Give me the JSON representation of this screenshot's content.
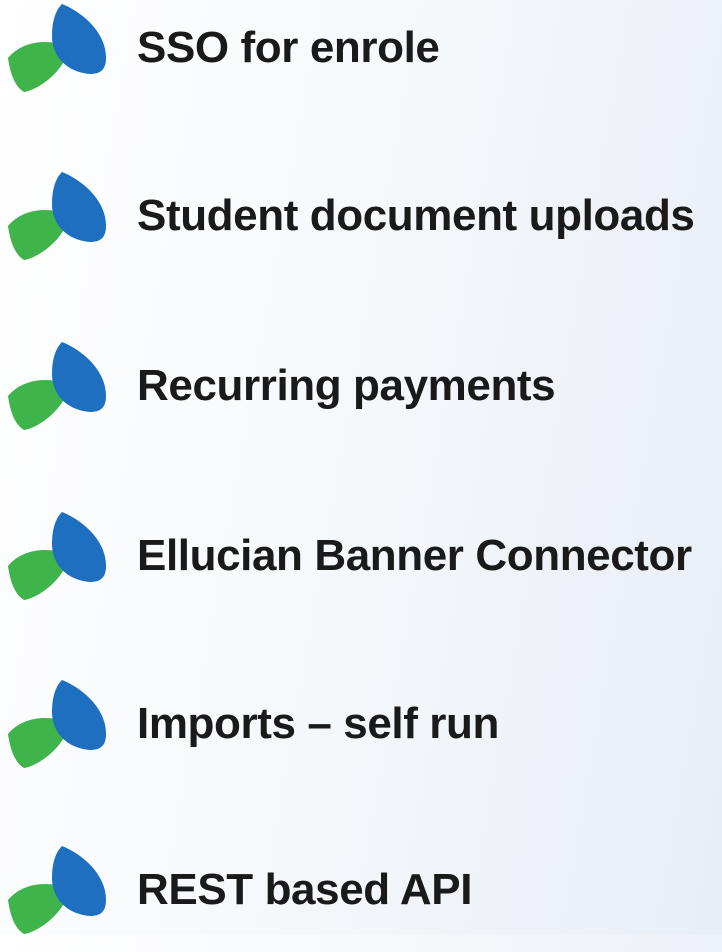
{
  "items": [
    {
      "label": "SSO for enrole",
      "icon": "leaf-logo-icon"
    },
    {
      "label": "Student document uploads",
      "icon": "leaf-logo-icon"
    },
    {
      "label": "Recurring payments",
      "icon": "leaf-logo-icon"
    },
    {
      "label": "Ellucian Banner Connector",
      "icon": "leaf-logo-icon"
    },
    {
      "label": "Imports – self run",
      "icon": "leaf-logo-icon"
    },
    {
      "label": "REST based API",
      "icon": "leaf-logo-icon"
    }
  ],
  "colors": {
    "leaf_blue": "#1f6fc1",
    "leaf_green": "#3fb44a",
    "text": "#1a1a1a"
  }
}
